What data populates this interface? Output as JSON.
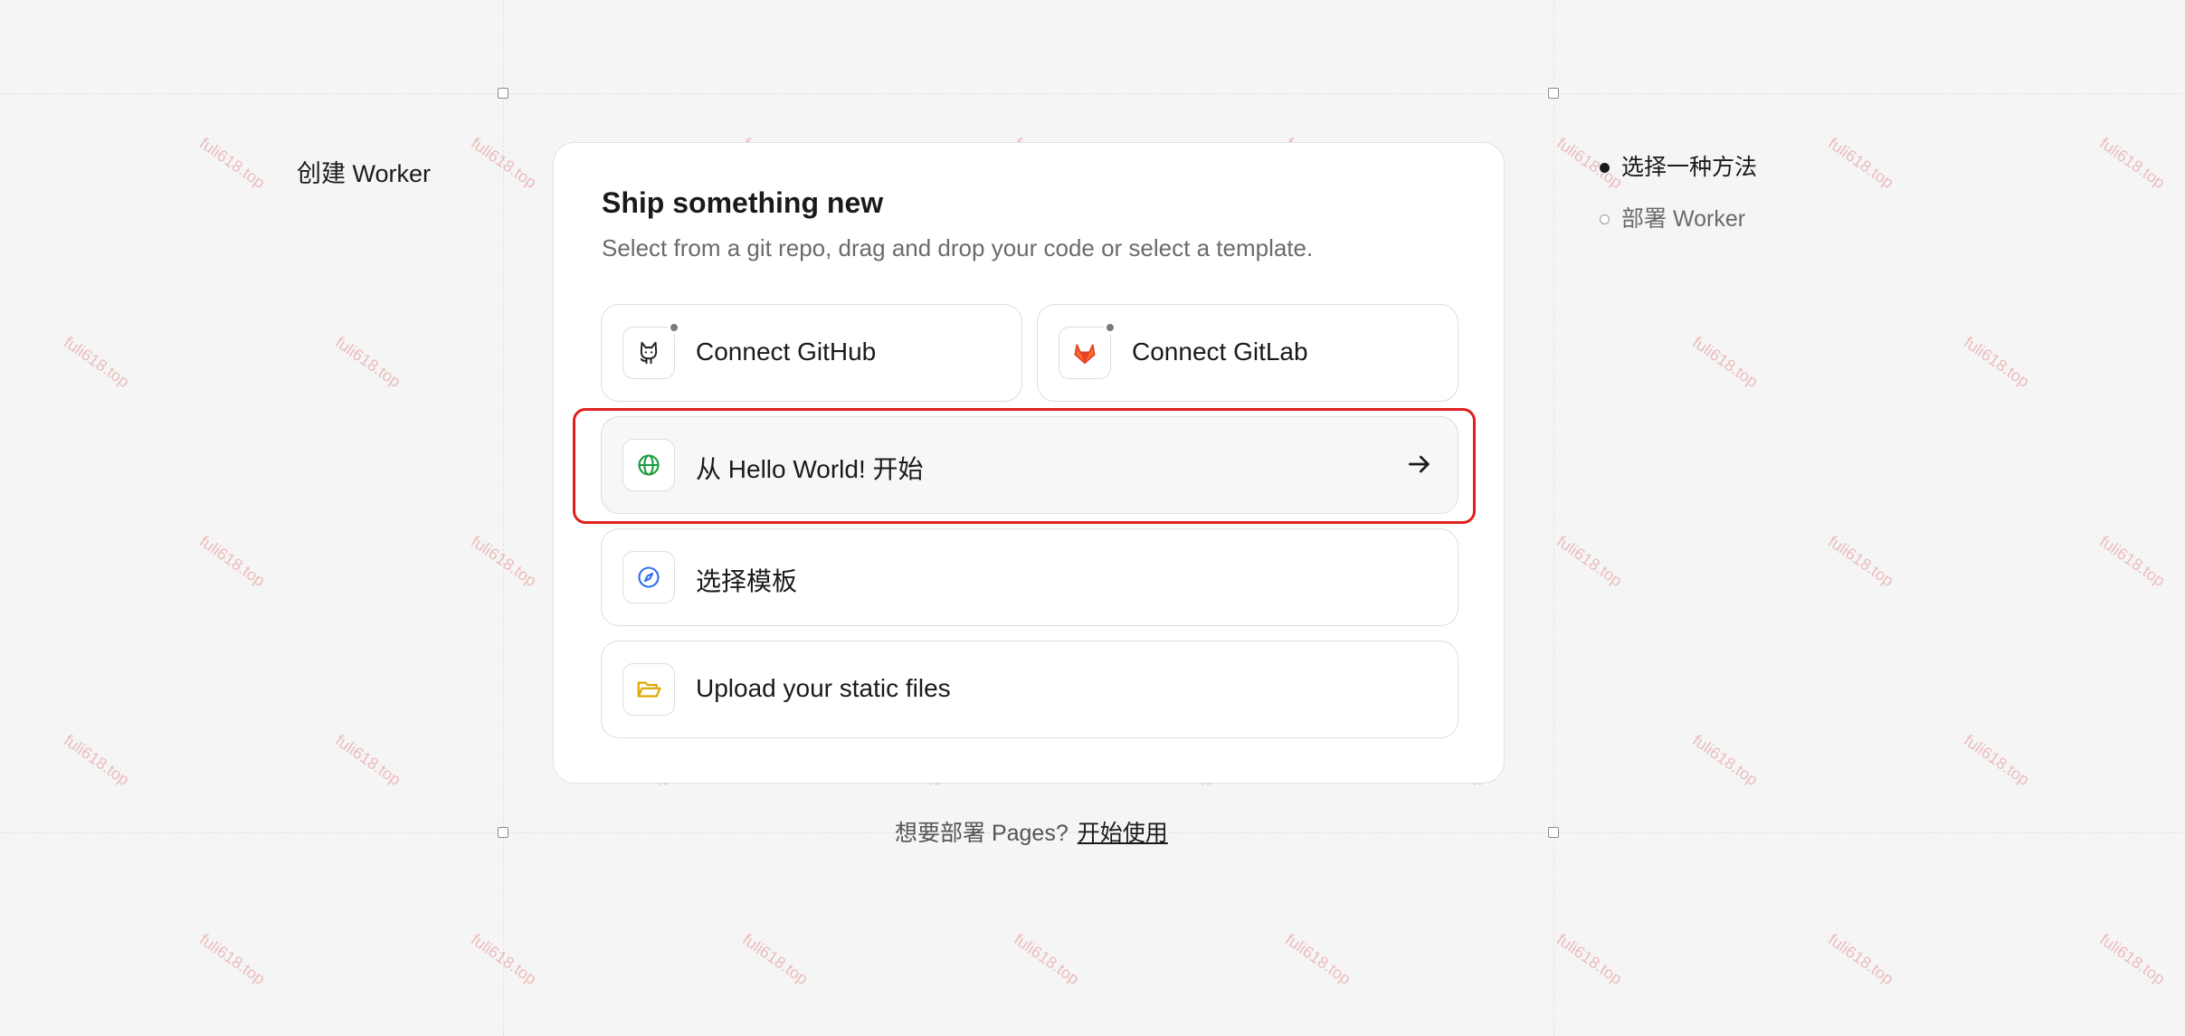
{
  "page": {
    "heading": "创建 Worker"
  },
  "card": {
    "title": "Ship something new",
    "subtitle": "Select from a git repo, drag and drop your code or select a template."
  },
  "options": {
    "github": {
      "label": "Connect GitHub",
      "icon": "github-icon"
    },
    "gitlab": {
      "label": "Connect GitLab",
      "icon": "gitlab-icon",
      "icon_color": "#e24329"
    },
    "hello_world": {
      "label": "从 Hello World! 开始",
      "icon": "globe-icon",
      "icon_color": "#1a9c3e"
    },
    "template": {
      "label": "选择模板",
      "icon": "compass-icon",
      "icon_color": "#2f6fed"
    },
    "upload": {
      "label": "Upload your static files",
      "icon": "folder-open-icon",
      "icon_color": "#e0a800"
    }
  },
  "footer": {
    "prompt": "想要部署 Pages?",
    "link": "开始使用"
  },
  "steps": [
    {
      "label": "选择一种方法",
      "state": "current"
    },
    {
      "label": "部署 Worker",
      "state": "pending"
    }
  ],
  "watermark": {
    "text": "fuli618.top",
    "color": "#e27878"
  },
  "highlight_color": "#e0201e"
}
